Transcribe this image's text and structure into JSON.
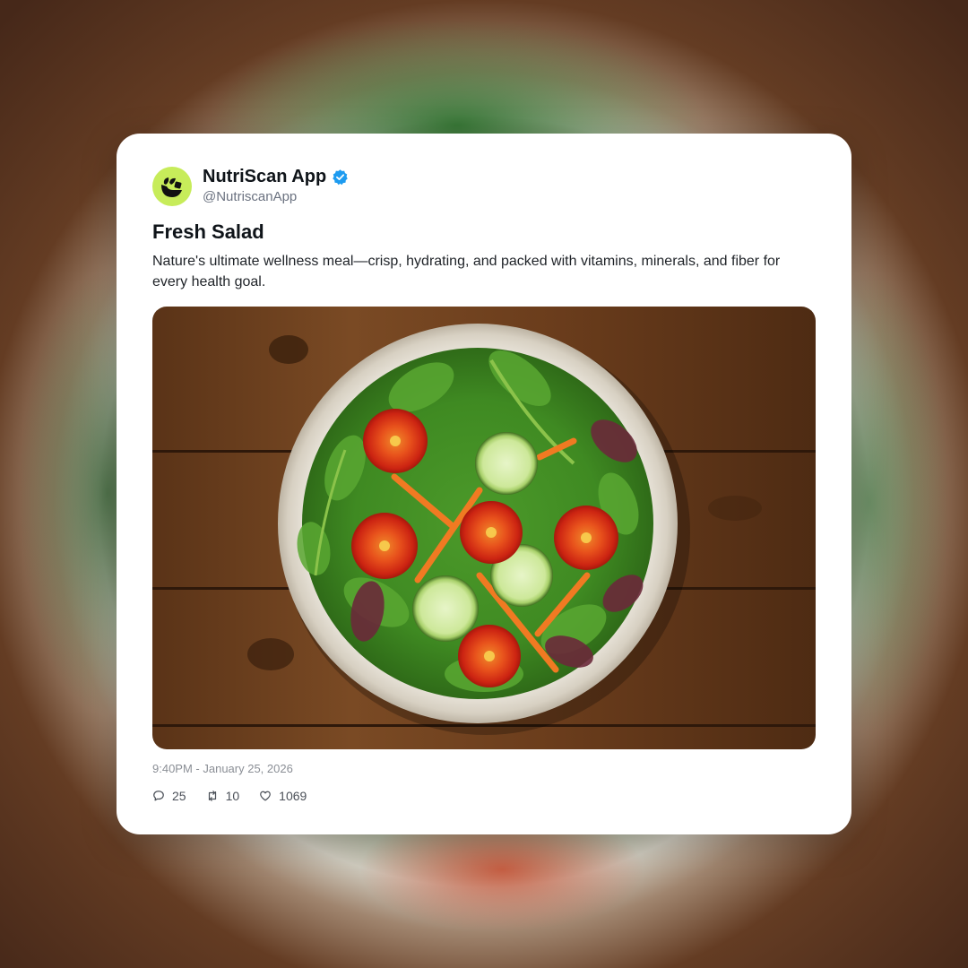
{
  "post": {
    "display_name": "NutriScan App",
    "handle": "@NutriscanApp",
    "verified": true,
    "title": "Fresh Salad",
    "body": "Nature's ultimate wellness meal—crisp, hydrating, and packed with vitamins, minerals, and fiber for every health goal.",
    "timestamp": "9:40PM - January 25, 2026",
    "stats": {
      "replies": "25",
      "reposts": "10",
      "likes": "1069"
    }
  },
  "colors": {
    "avatar_bg": "#c7ec5a",
    "verified_badge": "#1d9bf0",
    "card_bg": "#ffffff"
  },
  "icons": {
    "avatar": "nutriscan-logo-icon",
    "verified": "verified-badge-icon",
    "reply": "comment-icon",
    "repost": "repost-icon",
    "like": "heart-icon"
  }
}
